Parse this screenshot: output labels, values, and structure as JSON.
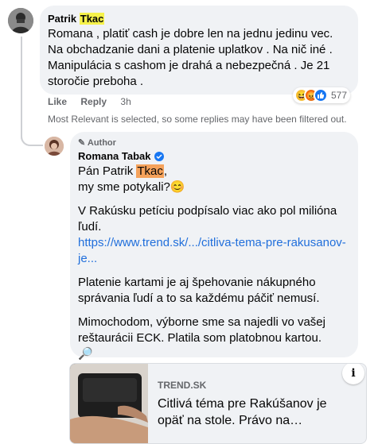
{
  "comment": {
    "author_first": "Patrik",
    "author_last": "Tkac",
    "lines": [
      "Romana , platiť cash je dobre len na jednu jedinu vec.",
      "Na obchadzanie dani a platenie uplatkov . Na nič iné .",
      "Manipulácia s cashom je drahá a nebezpečná . Je 21",
      "storočie preboha ."
    ],
    "like_label": "Like",
    "reply_label": "Reply",
    "time": "3h",
    "reaction_count": "577",
    "reactions": [
      "haha-icon",
      "angry-icon",
      "like-icon"
    ]
  },
  "filter_note": "Most Relevant is selected, so some replies may have been filtered out.",
  "reply": {
    "badge": "Author",
    "author": "Romana Tabak",
    "greeting_prefix": "Pán Patrik ",
    "greeting_name": "Tkac",
    "greeting_suffix": ",",
    "line2": "my sme potykali?",
    "emoji": "😊",
    "para1_line1": "V Rakúsku petíciu podpísalo viac ako pol milióna",
    "para1_line2": "ľudí.",
    "link_line1": "https://www.trend.sk/.../citliva-tema-pre-rakusanov-",
    "link_line2": "je...",
    "para2_line1": "Platenie kartami je aj špehovanie nákupného",
    "para2_line2": "správania ľudí a to sa každému páčiť nemusí.",
    "para3_line1": "Mimochodom, výborne sme sa najedli vo vašej",
    "para3_line2": "reštaurácii ECK. Platila som platobnou kartou.",
    "trailing_emoji": "🔎"
  },
  "link_card": {
    "site": "TREND.SK",
    "title_line1": "Citlivá téma pre Rakúšanov je",
    "title_line2": "opäť na stole. Právo na…",
    "info_icon_label": "i"
  },
  "colors": {
    "bubble": "#f0f2f5",
    "link": "#216fdb",
    "highlight_yellow": "#f6f24a",
    "highlight_orange": "#f5a25b",
    "verified": "#1877f2"
  }
}
